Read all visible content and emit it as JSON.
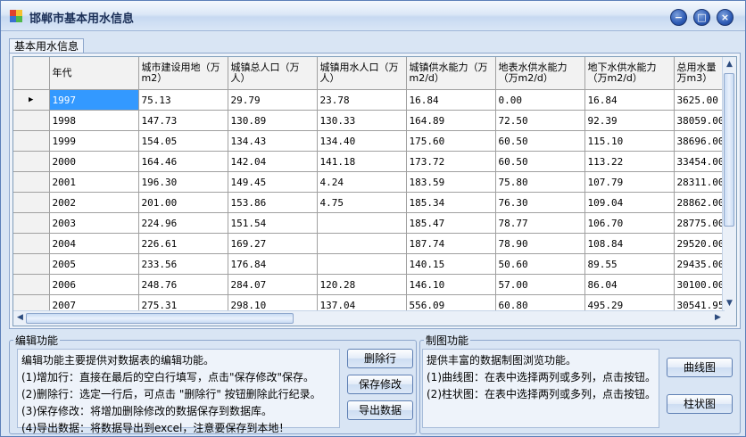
{
  "window": {
    "title": "邯郸市基本用水信息",
    "controls": [
      "−",
      "□",
      "×"
    ]
  },
  "tab": {
    "label": "基本用水信息"
  },
  "table": {
    "headers": [
      "年代",
      "城市建设用地（万m2）",
      "城镇总人口（万人）",
      "城镇用水人口（万人）",
      "城镇供水能力（万m2/d）",
      "地表水供水能力（万m2/d）",
      "地下水供水能力（万m2/d）",
      "总用水量万m3）"
    ],
    "rows": [
      [
        "1997",
        "75.13",
        "29.79",
        "23.78",
        "16.84",
        "0.00",
        "16.84",
        "3625.00"
      ],
      [
        "1998",
        "147.73",
        "130.89",
        "130.33",
        "164.89",
        "72.50",
        "92.39",
        "38059.00"
      ],
      [
        "1999",
        "154.05",
        "134.43",
        "134.40",
        "175.60",
        "60.50",
        "115.10",
        "38696.00"
      ],
      [
        "2000",
        "164.46",
        "142.04",
        "141.18",
        "173.72",
        "60.50",
        "113.22",
        "33454.00"
      ],
      [
        "2001",
        "196.30",
        "149.45",
        "4.24",
        "183.59",
        "75.80",
        "107.79",
        "28311.00"
      ],
      [
        "2002",
        "201.00",
        "153.86",
        "4.75",
        "185.34",
        "76.30",
        "109.04",
        "28862.00"
      ],
      [
        "2003",
        "224.96",
        "151.54",
        "",
        "185.47",
        "78.77",
        "106.70",
        "28775.00"
      ],
      [
        "2004",
        "226.61",
        "169.27",
        "",
        "187.74",
        "78.90",
        "108.84",
        "29520.00"
      ],
      [
        "2005",
        "233.56",
        "176.84",
        "",
        "140.15",
        "50.60",
        "89.55",
        "29435.00"
      ],
      [
        "2006",
        "248.76",
        "284.07",
        "120.28",
        "146.10",
        "57.00",
        "86.04",
        "30100.00"
      ],
      [
        "2007",
        "275.31",
        "298.10",
        "137.04",
        "556.09",
        "60.80",
        "495.29",
        "30541.95"
      ]
    ],
    "current_row_marker": "▶"
  },
  "edit_group": {
    "title": "编辑功能",
    "lines": [
      "编辑功能主要提供对数据表的编辑功能。",
      "(1)增加行：直接在最后的空白行填写，点击\"保存修改\"保存。",
      "(2)删除行：选定一行后，可点击 \"删除行\" 按钮删除此行纪录。",
      "(3)保存修改：将增加删除修改的数据保存到数据库。",
      "(4)导出数据：将数据导出到excel，注意要保存到本地！"
    ],
    "buttons": {
      "delete": "删除行",
      "save": "保存修改",
      "export": "导出数据"
    }
  },
  "chart_group": {
    "title": "制图功能",
    "lines": [
      "提供丰富的数据制图浏览功能。",
      "(1)曲线图：在表中选择两列或多列，点击按钮。",
      "(2)柱状图：在表中选择两列或多列，点击按钮。"
    ],
    "buttons": {
      "line": "曲线图",
      "bar": "柱状图"
    }
  }
}
